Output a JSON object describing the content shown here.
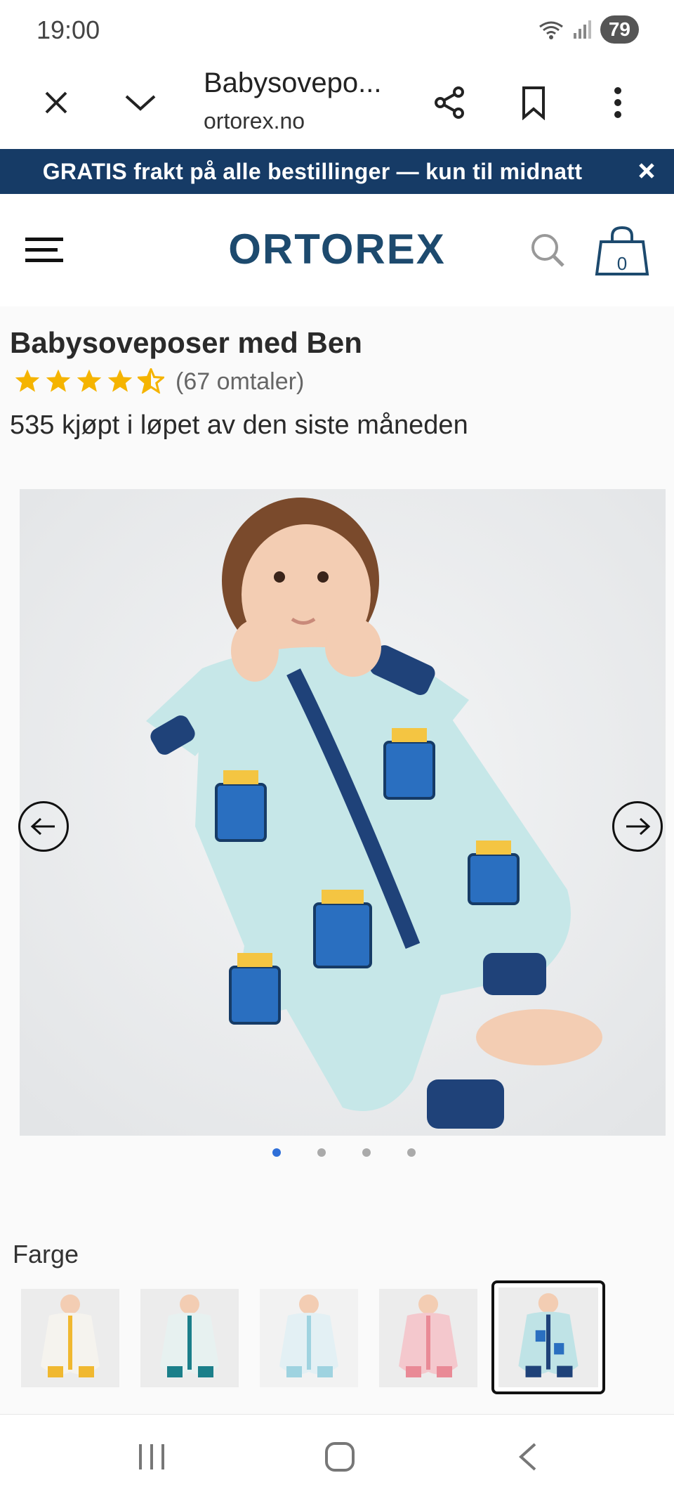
{
  "status": {
    "time": "19:00",
    "battery": "79"
  },
  "browser": {
    "title": "Babysovepo...",
    "url": "ortorex.no"
  },
  "promo": {
    "text": "GRATIS frakt på alle bestillinger — kun til midnatt"
  },
  "header": {
    "logo": "ORTOREX",
    "cart_count": "0"
  },
  "product": {
    "title": "Babysoveposer med Ben",
    "rating": 4.5,
    "reviews": "(67 omtaler)",
    "bought": "535 kjøpt i løpet av den siste måneden",
    "gallery_slide": 1,
    "gallery_count": 4
  },
  "color": {
    "label": "Farge",
    "swatch_colors": [
      "#f5f3ee",
      "#e7f1f0",
      "#e3f0f4",
      "#f4c8cd",
      "#bfe3e6"
    ],
    "selected_index": 4
  },
  "colors": {
    "promo": "#163b66",
    "logo": "#1d4a6e",
    "star": "#f5b400",
    "active_dot": "#2f6fd8"
  }
}
